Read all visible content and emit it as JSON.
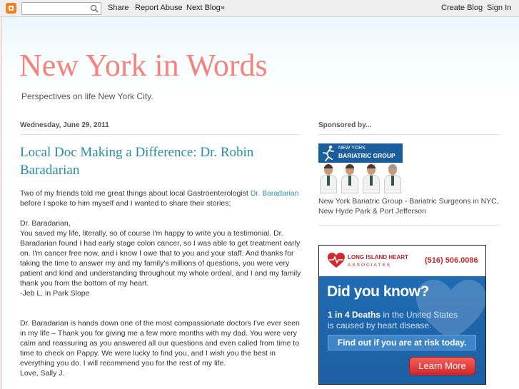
{
  "navbar": {
    "search_placeholder": "",
    "share": "Share",
    "report_abuse": "Report Abuse",
    "next_blog": "Next Blog»",
    "create_blog": "Create Blog",
    "sign_in": "Sign In"
  },
  "header": {
    "title": "New York in Words",
    "description": "Perspectives on life New York City."
  },
  "post": {
    "date": "Wednesday, June 29, 2011",
    "title": "Local Doc Making a Difference: Dr. Robin Baradarian",
    "intro_before_link": "Two of my friends told me great things about local Gastroenterologist ",
    "intro_link": "Dr. Baradarian",
    "intro_after_link": " before I spoke to him myself and I wanted to share their stories;",
    "letter1_salutation": "Dr. Baradarian,",
    "letter1_body": "You saved my life, literally, so of course I'm happy to write you a testimonial. Dr. Baradarian found I had early stage colon cancer, so I was able to get treatment early on. I'm cancer free now, and i know I owe that to you and your staff. And thanks for taking the time to answer my and my family's millions of questions, you were very patient and kind and understanding throughout my whole ordeal, and I and my family thank you from the bottom of my heart.",
    "letter1_sign": "-Jeb L. in Park Slope",
    "letter2_body": "Dr. Baradarian is hands down one of the most compassionate doctors I've ever seen in my life – Thank you for giving me a few more months with my dad. You were very calm and reassuring as you answered all our questions and even called from time to time to check on Pappy. We were lucky to find you, and I wish you the best in everything you do. I will recommend you for the rest of my life.",
    "letter2_sign": "Love, Sally J."
  },
  "sidebar": {
    "heading": "Sponsored by...",
    "ad1": {
      "banner_line1": "NEW YORK",
      "banner_line2": "BARIATRIC GROUP",
      "caption": "New York Bariatric Group - Bariatric Surgeons in NYC, New Hyde Park & Port Jefferson"
    },
    "ad2": {
      "name_line1": "LONG ISLAND HEART",
      "name_line2": "ASSOCIATES",
      "phone": "(516) 506.0086",
      "headline": "Did you know?",
      "stat_bold": "1 in 4 Deaths",
      "stat_rest": " in the United States",
      "stat_line2": "is caused by heart disease.",
      "risk_cta": "Find out if you are at risk today.",
      "button": "Learn More"
    }
  },
  "colors": {
    "title": "#f4837d",
    "link": "#2b8ea3",
    "ad_blue": "#1f6bb3",
    "ad_red": "#d2262b"
  }
}
